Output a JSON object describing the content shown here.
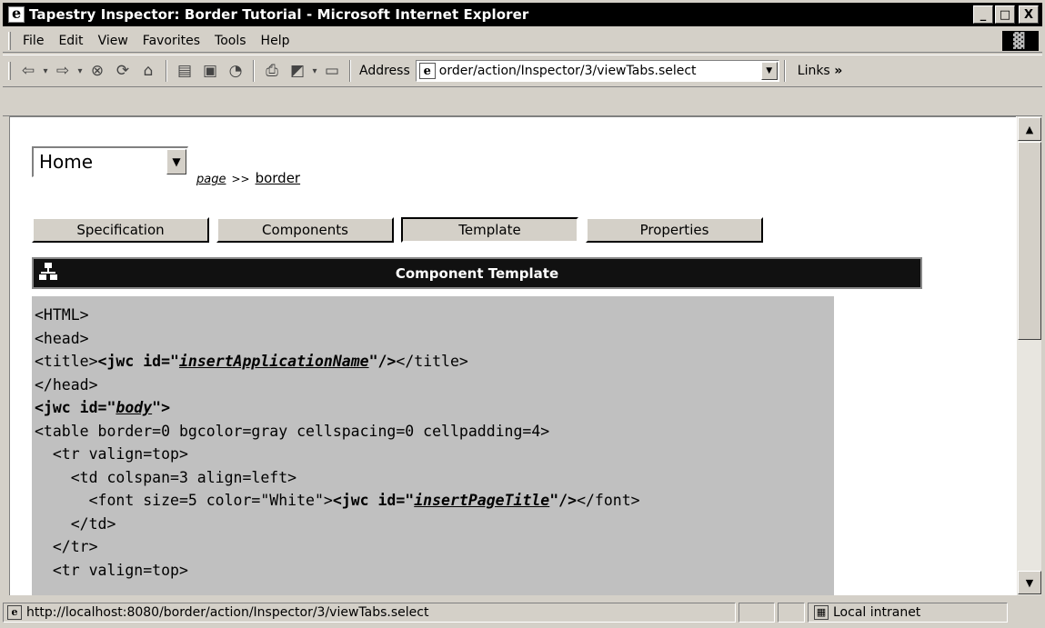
{
  "window": {
    "title": "Tapestry Inspector: Border Tutorial - Microsoft Internet Explorer",
    "minimize_label": "_",
    "maximize_label": "□",
    "close_label": "X"
  },
  "menu": {
    "items": [
      {
        "label": "File"
      },
      {
        "label": "Edit"
      },
      {
        "label": "View"
      },
      {
        "label": "Favorites"
      },
      {
        "label": "Tools"
      },
      {
        "label": "Help"
      }
    ]
  },
  "toolbar": {
    "address_label": "Address",
    "address_value": "order/action/Inspector/3/viewTabs.select",
    "links_label": "Links",
    "links_chevron": "»"
  },
  "inspector": {
    "page_select_value": "Home",
    "breadcrumb_page": "page",
    "breadcrumb_sep": ">>",
    "breadcrumb_component": "border",
    "tabs": [
      {
        "label": "Specification",
        "active": false
      },
      {
        "label": "Components",
        "active": false
      },
      {
        "label": "Template",
        "active": true
      },
      {
        "label": "Properties",
        "active": false
      }
    ],
    "section_title": "Component Template",
    "template_lines": [
      [
        {
          "t": "<HTML>"
        }
      ],
      [
        {
          "t": "<head>"
        }
      ],
      [
        {
          "t": "<title>"
        },
        {
          "t": "<jwc id=\"",
          "c": "jwc"
        },
        {
          "t": "insertApplicationName",
          "c": "jwc-id"
        },
        {
          "t": "\"/>",
          "c": "jwc"
        },
        {
          "t": "</title>"
        }
      ],
      [
        {
          "t": "</head>"
        }
      ],
      [
        {
          "t": "<jwc id=\"",
          "c": "jwc"
        },
        {
          "t": "body",
          "c": "jwc-id"
        },
        {
          "t": "\">",
          "c": "jwc"
        }
      ],
      [
        {
          "t": "<table border=0 bgcolor=gray cellspacing=0 cellpadding=4>"
        }
      ],
      [
        {
          "t": "  <tr valign=top>"
        }
      ],
      [
        {
          "t": "    <td colspan=3 align=left>"
        }
      ],
      [
        {
          "t": "      <font size=5 color=\"White\">"
        },
        {
          "t": "<jwc id=\"",
          "c": "jwc"
        },
        {
          "t": "insertPageTitle",
          "c": "jwc-id"
        },
        {
          "t": "\"/>",
          "c": "jwc"
        },
        {
          "t": "</font>"
        }
      ],
      [
        {
          "t": "    </td>"
        }
      ],
      [
        {
          "t": "  </tr>"
        }
      ],
      [
        {
          "t": "  <tr valign=top>"
        }
      ]
    ]
  },
  "status": {
    "text": "http://localhost:8080/border/action/Inspector/3/viewTabs.select",
    "zone": "Local intranet"
  },
  "colors": {
    "chrome": "#d4d0c8",
    "title_bar": "#000000",
    "template_bg": "#c0c0c0",
    "header_bar": "#111111"
  }
}
